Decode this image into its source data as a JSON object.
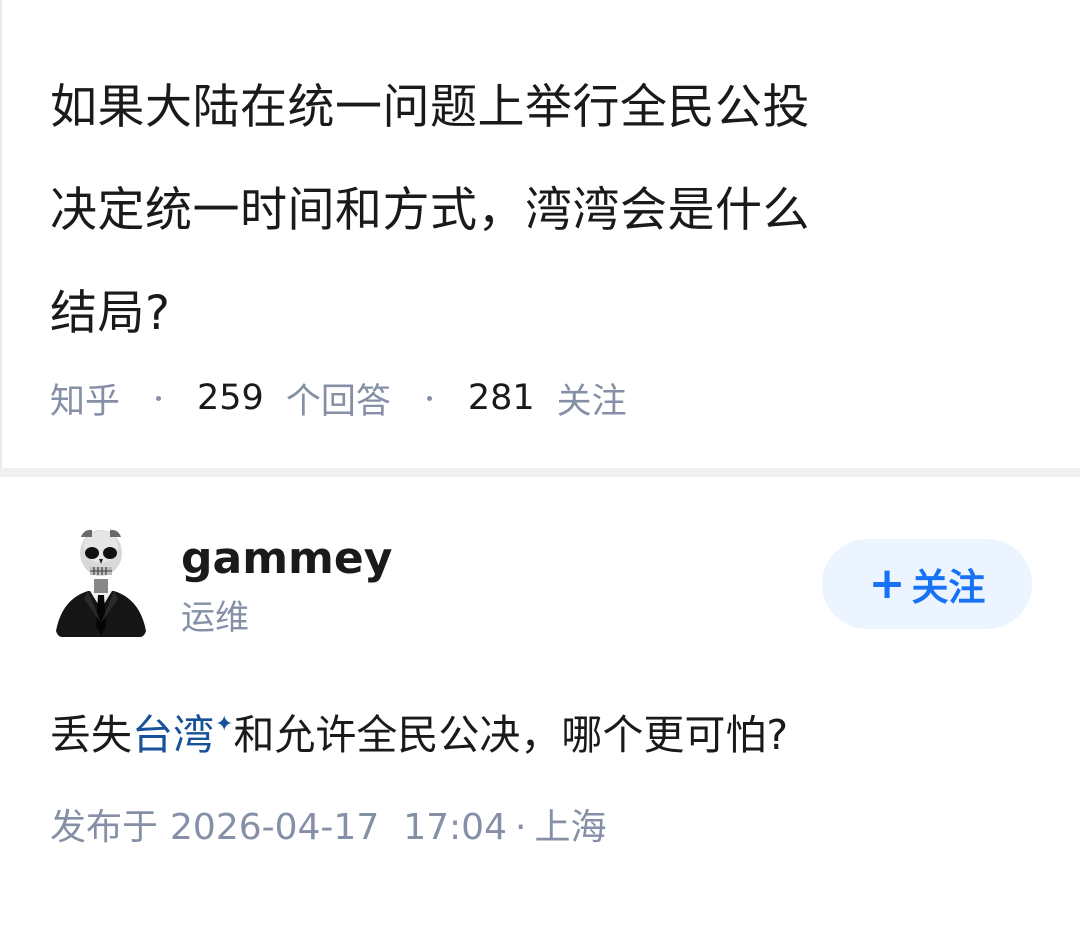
{
  "question": {
    "title_lines": [
      "如果大陆在统一问题上举行全民公投",
      "决定统一时间和方式，湾湾会是什么",
      "结局?"
    ],
    "source": "知乎",
    "answer_count": "259",
    "answer_label": "个回答",
    "follow_count": "281",
    "follow_label": "关注"
  },
  "author": {
    "name": "gammey",
    "bio": "运维",
    "avatar_icon": "skull-suit-avatar"
  },
  "follow_button": {
    "icon": "plus-icon",
    "label": "关注"
  },
  "answer": {
    "text_before": "丢失",
    "topic_link": "台湾",
    "topic_icon": "sparkle-icon",
    "text_after": "和允许全民公决，哪个更可怕?",
    "published_label": "发布于",
    "published_date": "2026-04-17",
    "published_time": "17:04",
    "location": "上海"
  },
  "colors": {
    "link": "#175199",
    "accent": "#1772f6",
    "meta_gray": "#8590a6",
    "follow_bg": "#ebf4ff"
  }
}
